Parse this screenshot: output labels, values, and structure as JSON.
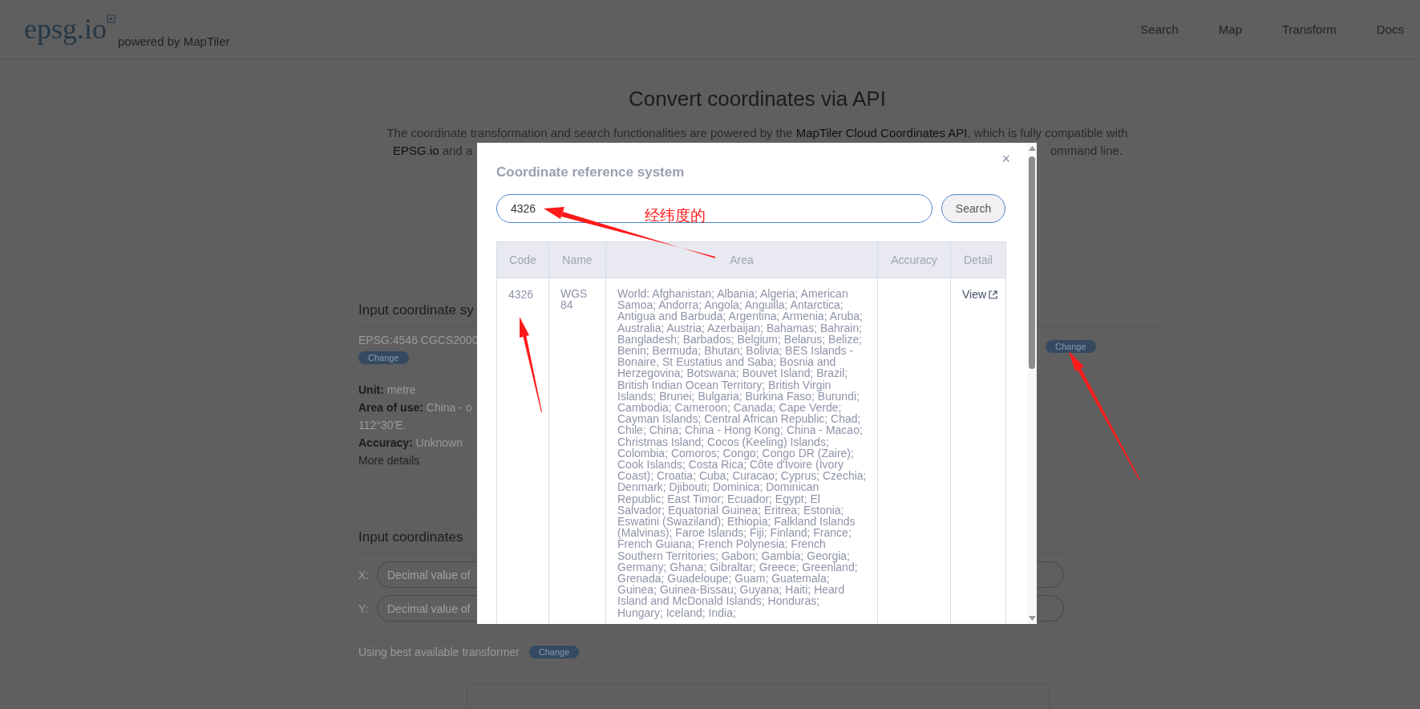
{
  "header": {
    "logo": "epsg.io",
    "tagline": "powered by MapTiler",
    "nav": [
      {
        "label": "Search"
      },
      {
        "label": "Map"
      },
      {
        "label": "Transform"
      },
      {
        "label": "Docs"
      }
    ]
  },
  "intro": {
    "title": "Convert coordinates via API",
    "line_1": "The coordinate transformation and search functionalities are powered by the **MapTiler Cloud Coordinates API**, which is fully compatible with",
    "line_2_start": "**EPSG.io** and a",
    "line_2_end": "ommand line."
  },
  "input_system": {
    "heading": "Input coordinate sy",
    "crs": "EPSG:4546 CGCS2000",
    "change": "Change",
    "details": [
      {
        "kind": "field",
        "label": "Unit:",
        "value": "metre"
      },
      {
        "kind": "field",
        "label": "Area of use:",
        "value": "China - o"
      },
      {
        "kind": "plain",
        "value": "112°30'E."
      },
      {
        "kind": "field",
        "label": "Accuracy:",
        "value": "Unknown"
      },
      {
        "kind": "link",
        "value": "More details"
      }
    ]
  },
  "output_system": {
    "change": "Change"
  },
  "input_coordinates": {
    "heading": "Input coordinates",
    "fields": [
      {
        "label": "X:",
        "placeholder": "Decimal value of"
      },
      {
        "label": "Y:",
        "placeholder": "Decimal value of"
      }
    ]
  },
  "transformer": {
    "text": "Using best available transformer",
    "change": "Change"
  },
  "dialog": {
    "title": "Coordinate reference system",
    "close": "×",
    "search": {
      "value": "4326",
      "button": "Search"
    },
    "table": {
      "columns": [
        "Code",
        "Name",
        "Area",
        "Accuracy",
        "Detail"
      ],
      "rows": [
        {
          "code": "4326",
          "name": "WGS 84",
          "area": "World: Afghanistan; Albania; Algeria; American Samoa; Andorra; Angola; Anguilla; Antarctica; Antigua and Barbuda; Argentina; Armenia; Aruba; Australia; Austria; Azerbaijan; Bahamas; Bahrain; Bangladesh; Barbados; Belgium; Belarus; Belize; Benin; Bermuda; Bhutan; Bolivia; BES Islands - Bonaire, St Eustatius and Saba; Bosnia and Herzegovina; Botswana; Bouvet Island; Brazil; British Indian Ocean Territory; British Virgin Islands; Brunei; Bulgaria; Burkina Faso; Burundi; Cambodia; Cameroon; Canada; Cape Verde; Cayman Islands; Central African Republic; Chad; Chile; China; China - Hong Kong; China - Macao; Christmas Island; Cocos (Keeling) Islands; Colombia; Comoros; Congo; Congo DR (Zaire); Cook Islands; Costa Rica; Côte d'Ivoire (Ivory Coast); Croatia; Cuba; Curacao; Cyprus; Czechia; Denmark; Djibouti; Dominica; Dominican Republic; East Timor; Ecuador; Egypt; El Salvador; Equatorial Guinea; Eritrea; Estonia; Eswatini (Swaziland); Ethiopia; Falkland Islands (Malvinas); Faroe Islands; Fiji; Finland; France; French Guiana; French Polynesia; French Southern Territories; Gabon; Gambia; Georgia; Germany; Ghana; Gibraltar; Greece; Greenland; Grenada; Guadeloupe; Guam; Guatemala; Guinea; Guinea-Bissau; Guyana; Haiti; Heard Island and McDonald Islands; Honduras; Hungary; Iceland; India;",
          "link": "View"
        }
      ]
    }
  },
  "annotation": {
    "note": "经纬度的"
  }
}
